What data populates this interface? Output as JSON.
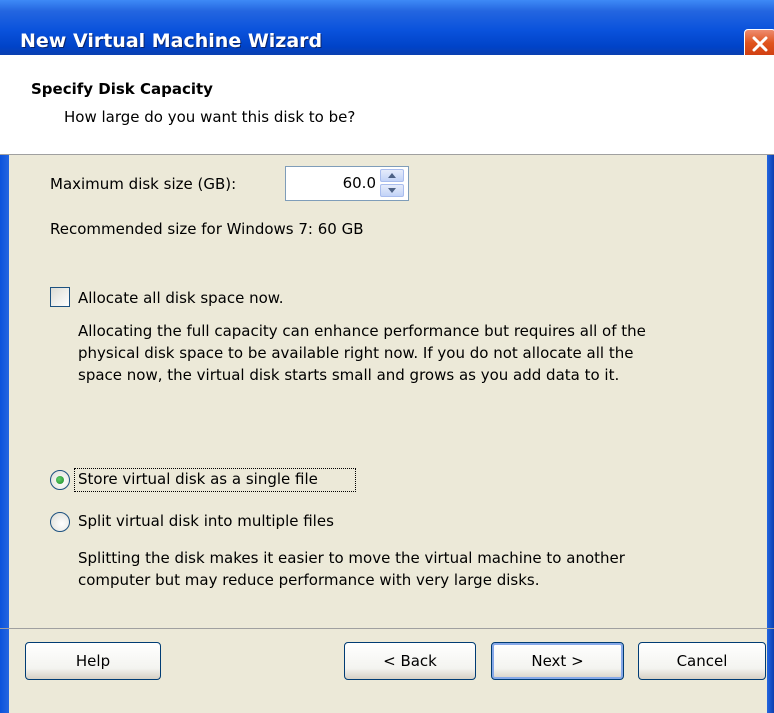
{
  "window": {
    "title": "New Virtual Machine Wizard"
  },
  "header": {
    "title": "Specify Disk Capacity",
    "subtitle": "How large do you want this disk to be?"
  },
  "disk_size": {
    "label": "Maximum disk size (GB):",
    "value": "60.0",
    "recommended": "Recommended size for Windows 7: 60 GB"
  },
  "allocate": {
    "label": "Allocate all disk space now.",
    "checked": false,
    "description_lines": [
      "Allocating the full capacity can enhance performance but requires all of the",
      "physical disk space to be available right now. If you do not allocate all the",
      "space now, the virtual disk starts small and grows as you add data to it."
    ]
  },
  "storage": {
    "options": [
      {
        "label": "Store virtual disk as a single file",
        "selected": true
      },
      {
        "label": "Split virtual disk into multiple files",
        "selected": false
      }
    ],
    "description_lines": [
      "Splitting the disk makes it easier to move the virtual machine to another",
      "computer but may reduce performance with very large disks."
    ]
  },
  "footer": {
    "help": "Help",
    "back": "< Back",
    "next": "Next >",
    "cancel": "Cancel"
  },
  "colors": {
    "titlebar": "#0a52dc",
    "window_bg": "#ece9d8",
    "close_button": "#e0541d",
    "radio_dot": "#1f8a2a"
  }
}
